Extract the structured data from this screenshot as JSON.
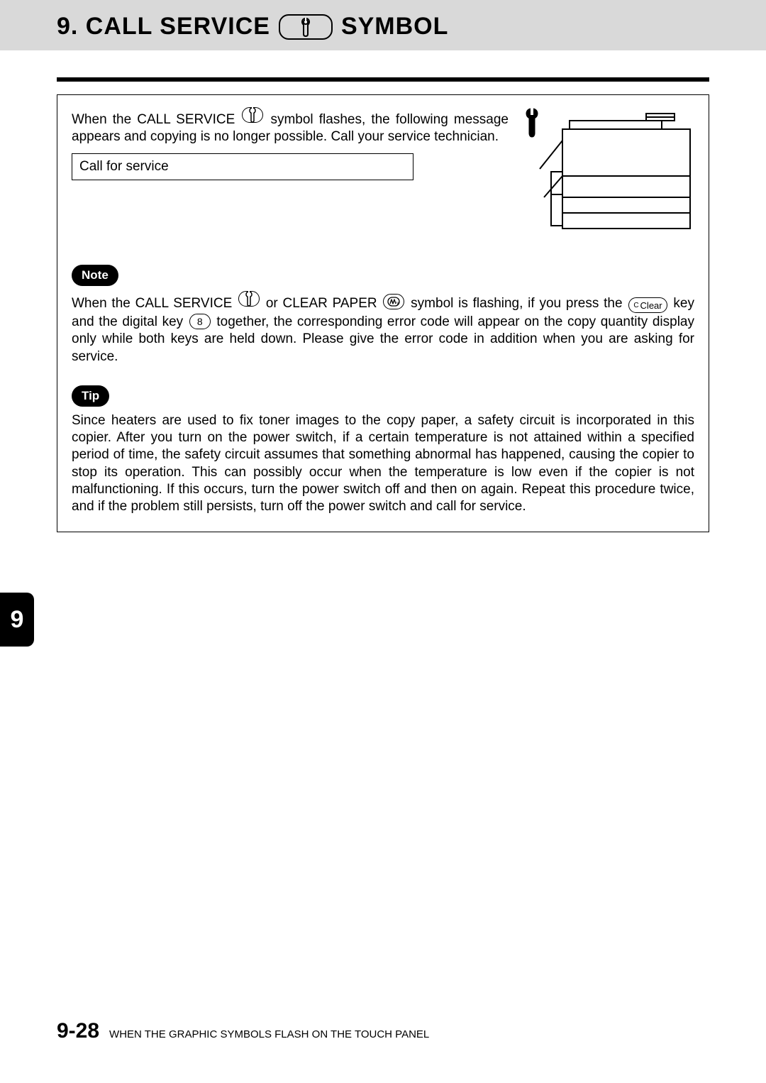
{
  "header": {
    "title_prefix": "9. CALL SERVICE",
    "title_suffix": "SYMBOL"
  },
  "intro": {
    "pre1": "When the CALL SERVICE ",
    "post1": " symbol flashes, the following message appears and copying is no longer possible. Call your service technician."
  },
  "message_box": "Call for service",
  "note": {
    "label": "Note",
    "p1": "When the CALL SERVICE ",
    "p2": " or CLEAR PAPER ",
    "p3": " symbol is flashing, if you press the ",
    "clear_small": "C",
    "clear": "Clear",
    "p4": " key and the digital key ",
    "eight": "8",
    "p5": " together, the corresponding error code will appear on the copy quantity display only while both keys are held down. Please give the error code in addition when you are asking for service."
  },
  "tip": {
    "label": "Tip",
    "text": "Since heaters are used to fix toner images to the copy paper, a safety circuit is incorporated in this copier. After you turn on the power switch, if a certain temperature is not attained within a specified period of time, the safety circuit assumes that something abnormal has happened, causing the copier to stop its operation. This can possibly occur when the temperature is low even if the copier is not malfunctioning. If this occurs, turn the power switch off and then on again. Repeat this procedure twice, and if the problem still persists, turn off the power switch and call for service."
  },
  "side_index": "9",
  "footer": {
    "page": "9-28",
    "text": "WHEN THE GRAPHIC SYMBOLS FLASH ON THE TOUCH PANEL"
  }
}
